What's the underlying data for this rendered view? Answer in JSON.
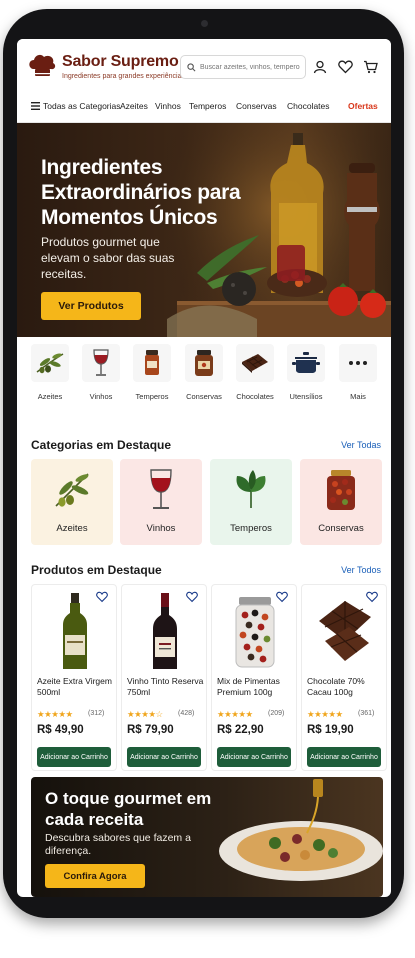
{
  "brand": {
    "title": "Sabor Supremo",
    "subtitle": "Ingredientes para grandes experiências"
  },
  "search": {
    "placeholder": "Buscar azeites, vinhos, temperos..."
  },
  "header_icons": [
    "user-icon",
    "heart-icon",
    "cart-icon"
  ],
  "nav": {
    "all_categories": "Todas as Categorias",
    "items": [
      "Azeites",
      "Vinhos",
      "Temperos",
      "Conservas",
      "Chocolates"
    ],
    "offers": "Ofertas"
  },
  "hero": {
    "title": "Ingredientes Extraordinários para Momentos Únicos",
    "subtitle": "Produtos gourmet que elevam o sabor das suas receitas.",
    "button": "Ver Produtos"
  },
  "icon_strip": [
    {
      "label": "Azeites",
      "icon": "olive-branch-icon"
    },
    {
      "label": "Vinhos",
      "icon": "wine-glass-icon"
    },
    {
      "label": "Temperos",
      "icon": "spice-jar-icon"
    },
    {
      "label": "Conservas",
      "icon": "preserve-jar-icon"
    },
    {
      "label": "Chocolates",
      "icon": "chocolate-bar-icon"
    },
    {
      "label": "Utensílios",
      "icon": "pot-icon"
    },
    {
      "label": "Mais",
      "icon": "more-dots-icon"
    }
  ],
  "featured_categories": {
    "title": "Categorias em Destaque",
    "link": "Ver Todas",
    "items": [
      {
        "label": "Azeites",
        "bg": "#fbf2e1"
      },
      {
        "label": "Vinhos",
        "bg": "#fbe7e5"
      },
      {
        "label": "Temperos",
        "bg": "#e9f5ec"
      },
      {
        "label": "Conservas",
        "bg": "#fbe6e3"
      }
    ]
  },
  "featured_products": {
    "title": "Produtos em Destaque",
    "link": "Ver Todos",
    "add_label": "Adicionar ao Carrinho",
    "items": [
      {
        "name": "Azeite Extra Virgem 500ml",
        "stars": "★★★★★",
        "rating": 5,
        "reviews": "(312)",
        "price": "R$ 49,90"
      },
      {
        "name": "Vinho Tinto Reserva 750ml",
        "stars": "★★★★☆",
        "rating": 4,
        "reviews": "(428)",
        "price": "R$ 79,90"
      },
      {
        "name": "Mix de Pimentas Premium 100g",
        "stars": "★★★★★",
        "rating": 5,
        "reviews": "(209)",
        "price": "R$ 22,90"
      },
      {
        "name": "Chocolate 70% Cacau 100g",
        "stars": "★★★★★",
        "rating": 5,
        "reviews": "(361)",
        "price": "R$ 19,90"
      }
    ]
  },
  "promo": {
    "title": "O toque gourmet em cada receita",
    "subtitle": "Descubra sabores que fazem a diferença.",
    "button": "Confira Agora"
  },
  "colors": {
    "brand": "#6a1e12",
    "accent": "#f5b619",
    "offer": "#d8361a",
    "cart_button": "#1e5d3a",
    "link": "#1a5fb8",
    "star": "#f0a51c"
  }
}
